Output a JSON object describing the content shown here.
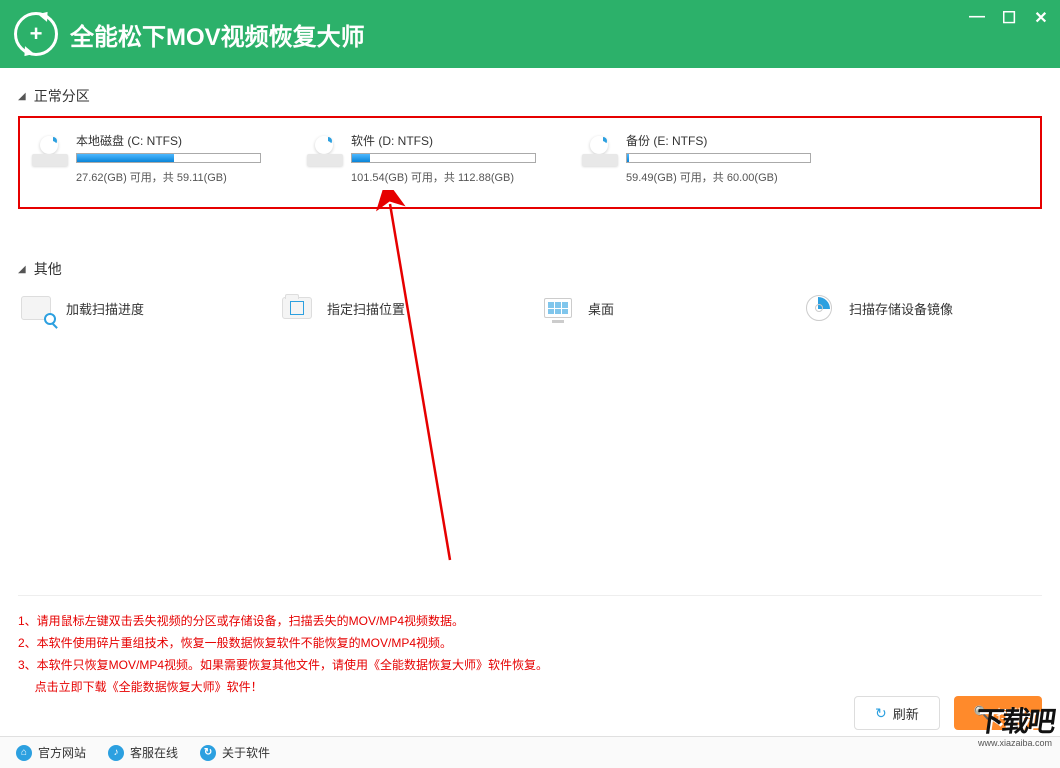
{
  "app": {
    "title": "全能松下MOV视频恢复大师"
  },
  "sections": {
    "partitions_label": "正常分区",
    "other_label": "其他"
  },
  "partitions": [
    {
      "name": "本地磁盘 (C: NTFS)",
      "free": "27.62(GB)",
      "total": "59.11(GB)",
      "used_pct": 53
    },
    {
      "name": "软件 (D: NTFS)",
      "free": "101.54(GB)",
      "total": "112.88(GB)",
      "used_pct": 10
    },
    {
      "name": "备份 (E: NTFS)",
      "free": "59.49(GB)",
      "total": "60.00(GB)",
      "used_pct": 1
    }
  ],
  "stats_template": {
    "free_suffix": " 可用，共 "
  },
  "other_items": [
    {
      "label": "加载扫描进度"
    },
    {
      "label": "指定扫描位置"
    },
    {
      "label": "桌面"
    },
    {
      "label": "扫描存储设备镜像"
    }
  ],
  "tips": [
    "1、请用鼠标左键双击丢失视频的分区或存储设备，扫描丢失的MOV/MP4视频数据。",
    "2、本软件使用碎片重组技术，恢复一般数据恢复软件不能恢复的MOV/MP4视频。",
    "3、本软件只恢复MOV/MP4视频。如果需要恢复其他文件，请使用《全能数据恢复大师》软件恢复。"
  ],
  "tips_link": "点击立即下载《全能数据恢复大师》软件！",
  "buttons": {
    "refresh": "刷新",
    "scan": "扫描"
  },
  "footer": [
    {
      "icon": "⌂",
      "label": "官方网站"
    },
    {
      "icon": "♪",
      "label": "客服在线"
    },
    {
      "icon": "↻",
      "label": "关于软件"
    }
  ],
  "watermark": {
    "text": "下载吧",
    "url": "www.xiazaiba.com"
  }
}
